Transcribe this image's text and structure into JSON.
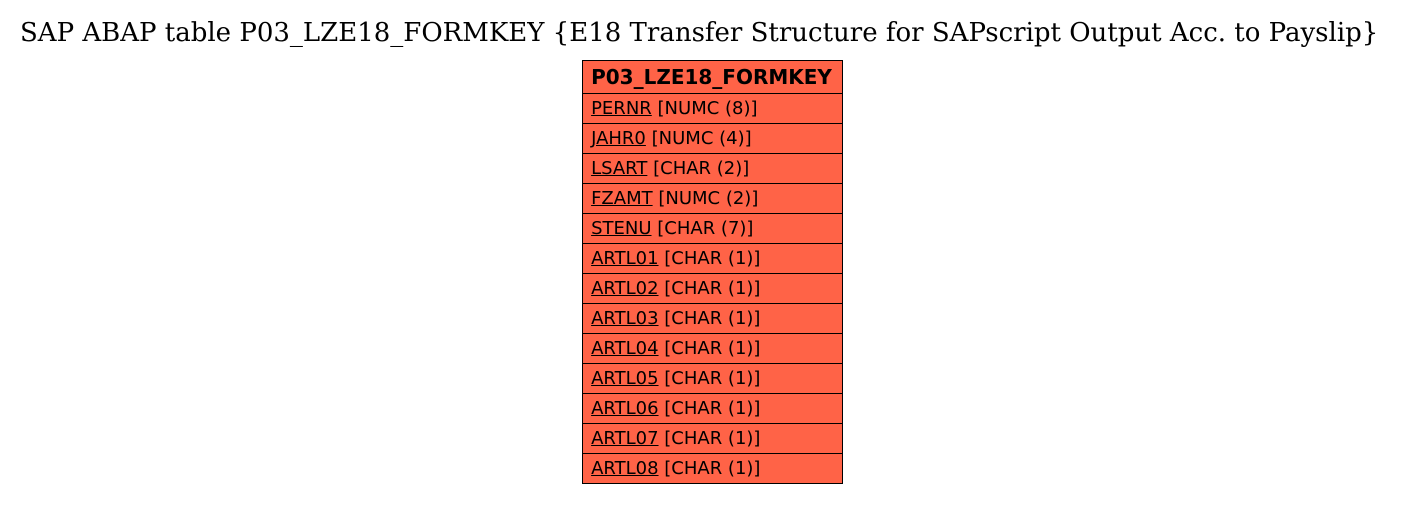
{
  "title": "SAP ABAP table P03_LZE18_FORMKEY {E18 Transfer Structure for SAPscript Output Acc. to Payslip}",
  "table": {
    "name": "P03_LZE18_FORMKEY",
    "fields": [
      {
        "name": "PERNR",
        "type": "[NUMC (8)]"
      },
      {
        "name": "JAHR0",
        "type": "[NUMC (4)]"
      },
      {
        "name": "LSART",
        "type": "[CHAR (2)]"
      },
      {
        "name": "FZAMT",
        "type": "[NUMC (2)]"
      },
      {
        "name": "STENU",
        "type": "[CHAR (7)]"
      },
      {
        "name": "ARTL01",
        "type": "[CHAR (1)]"
      },
      {
        "name": "ARTL02",
        "type": "[CHAR (1)]"
      },
      {
        "name": "ARTL03",
        "type": "[CHAR (1)]"
      },
      {
        "name": "ARTL04",
        "type": "[CHAR (1)]"
      },
      {
        "name": "ARTL05",
        "type": "[CHAR (1)]"
      },
      {
        "name": "ARTL06",
        "type": "[CHAR (1)]"
      },
      {
        "name": "ARTL07",
        "type": "[CHAR (1)]"
      },
      {
        "name": "ARTL08",
        "type": "[CHAR (1)]"
      }
    ]
  }
}
